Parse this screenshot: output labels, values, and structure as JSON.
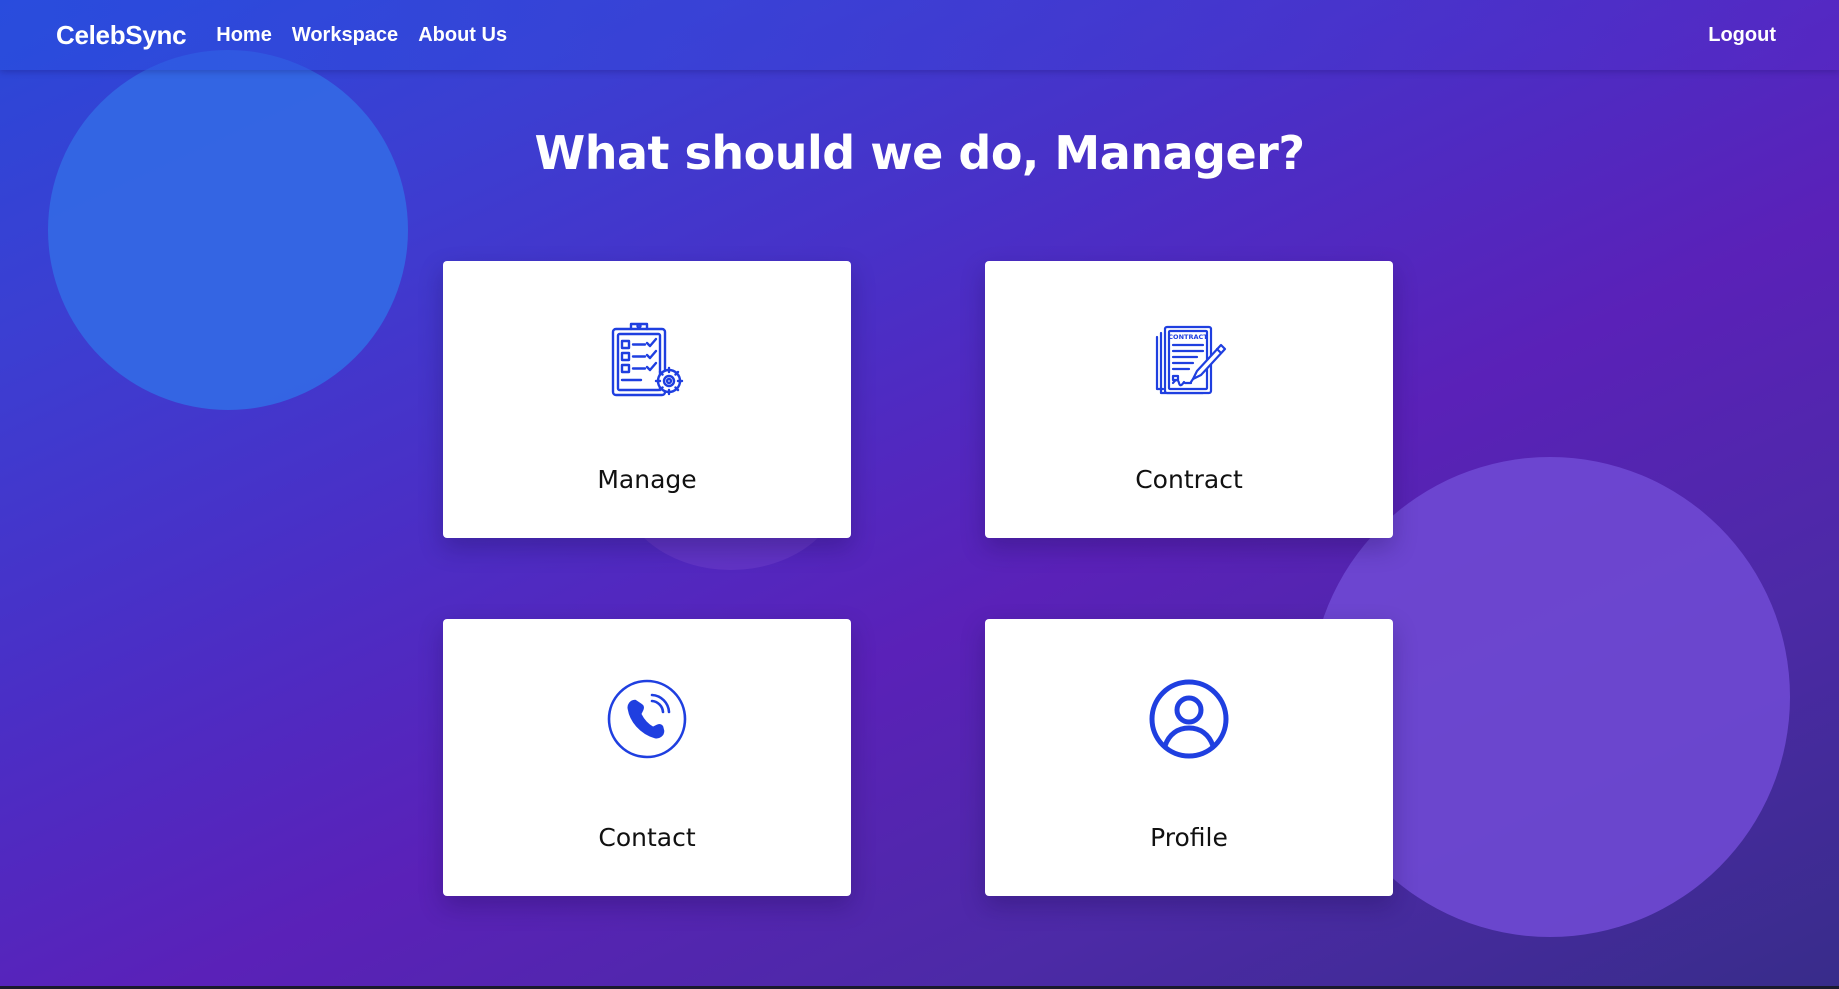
{
  "navbar": {
    "brand": "CelebSync",
    "links": [
      "Home",
      "Workspace",
      "About Us"
    ],
    "logout_label": "Logout"
  },
  "main": {
    "title": "What should we do, Manager?",
    "cards": [
      {
        "label": "Manage",
        "icon": "clipboard-checklist-gear-icon"
      },
      {
        "label": "Contract",
        "icon": "contract-pen-icon"
      },
      {
        "label": "Contact",
        "icon": "phone-circle-icon"
      },
      {
        "label": "Profile",
        "icon": "user-circle-icon"
      }
    ]
  },
  "colors": {
    "icon": "#1f3fe0",
    "card_bg": "#ffffff",
    "bg_start": "#2a48d8",
    "bg_end": "#382c8a"
  }
}
